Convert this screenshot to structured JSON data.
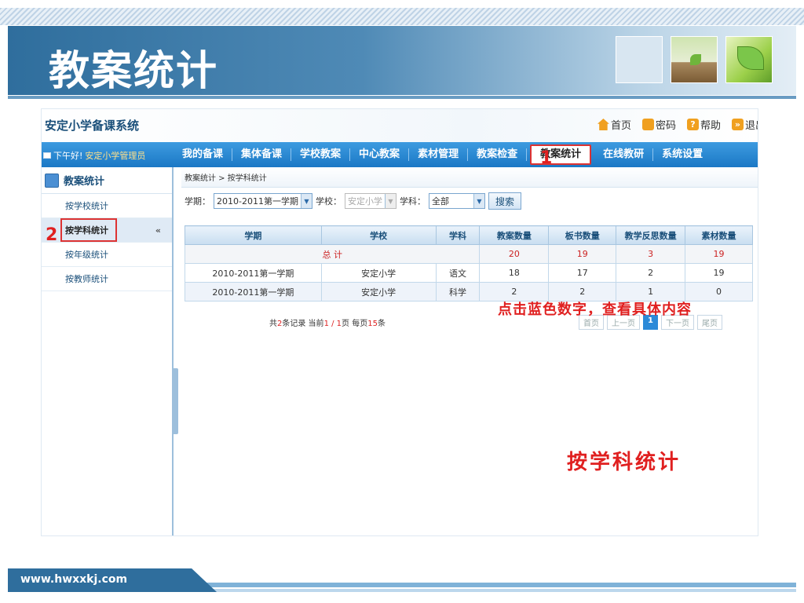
{
  "slide": {
    "title": "教案统计",
    "url": "www.hwxxkj.com"
  },
  "app": {
    "system_name": "安定小学备课系统",
    "top_links": [
      "首页",
      "密码",
      "帮助",
      "退出"
    ],
    "greeting": "下午好!",
    "user": "安定小学管理员",
    "nav": [
      "我的备课",
      "集体备课",
      "学校教案",
      "中心教案",
      "素材管理",
      "教案检查",
      "教案统计",
      "在线教研",
      "系统设置"
    ],
    "active_nav": "教案统计"
  },
  "sidebar": {
    "title": "教案统计",
    "items": [
      "按学校统计",
      "按学科统计",
      "按年级统计",
      "按教师统计"
    ],
    "active": "按学科统计",
    "collapse": "«"
  },
  "breadcrumb": "教案统计 > 按学科统计",
  "filters": {
    "term_label": "学期：",
    "term_value": "2010-2011第一学期",
    "school_label": "学校：",
    "school_value": "安定小学",
    "subject_label": "学科：",
    "subject_value": "全部",
    "search_label": "搜索"
  },
  "table": {
    "headers": [
      "学期",
      "学校",
      "学科",
      "教案数量",
      "板书数量",
      "教学反思数量",
      "素材数量"
    ],
    "total_label": "总 计",
    "total": [
      "20",
      "19",
      "3",
      "19"
    ],
    "rows": [
      [
        "2010-2011第一学期",
        "安定小学",
        "语文",
        "18",
        "17",
        "2",
        "19"
      ],
      [
        "2010-2011第一学期",
        "安定小学",
        "科学",
        "2",
        "2",
        "1",
        "0"
      ]
    ]
  },
  "pager": {
    "prefix": "共",
    "records": "2",
    "records_suffix": "条记录  当前",
    "page": "1 / 1",
    "page_suffix": "页  每页",
    "per": "15",
    "per_suffix": "条",
    "buttons": [
      "首页",
      "上一页",
      "1",
      "下一页",
      "尾页"
    ]
  },
  "annotations": {
    "num1": "1",
    "num2": "2",
    "tip": "点击蓝色数字，查看具体内容",
    "big": "按学科统计"
  },
  "colors": {
    "nav_blue": "#1b78c5",
    "annotation_red": "#e02020",
    "title_band": "#2f6e9d"
  }
}
